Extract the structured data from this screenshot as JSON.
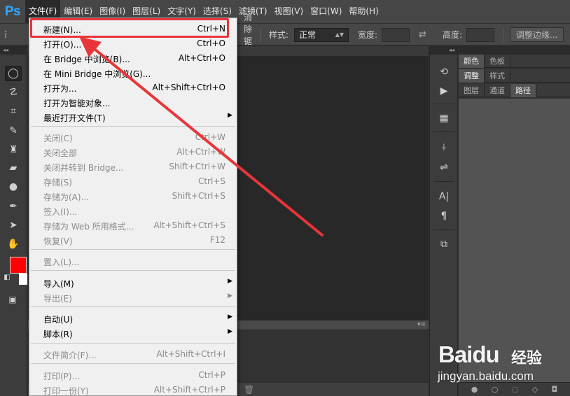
{
  "app": {
    "logo": "Ps"
  },
  "menubar": {
    "items": [
      "文件(F)",
      "编辑(E)",
      "图像(I)",
      "图层(L)",
      "文字(Y)",
      "选择(S)",
      "滤镜(T)",
      "视图(V)",
      "窗口(W)",
      "帮助(H)"
    ],
    "active": "文件(F)"
  },
  "options_bar": {
    "style_label": "样式:",
    "style_value": "正常",
    "width_label": "宽度:",
    "height_label": "高度:",
    "refine_edge_button": "调整边缘...",
    "partial_text": "消除锯齿"
  },
  "file_menu": {
    "items": [
      {
        "label": "新建(N)...",
        "shortcut": "Ctrl+N",
        "enabled": true,
        "highlighted": true
      },
      {
        "label": "打开(O)...",
        "shortcut": "Ctrl+O",
        "enabled": true
      },
      {
        "label": "在 Bridge 中浏览(B)...",
        "shortcut": "Alt+Ctrl+O",
        "enabled": true
      },
      {
        "label": "在 Mini Bridge 中浏览(G)...",
        "shortcut": "",
        "enabled": true
      },
      {
        "label": "打开为...",
        "shortcut": "Alt+Shift+Ctrl+O",
        "enabled": true
      },
      {
        "label": "打开为智能对象...",
        "shortcut": "",
        "enabled": true
      },
      {
        "label": "最近打开文件(T)",
        "shortcut": "",
        "enabled": true,
        "submenu": true
      },
      {
        "label": "关闭(C)",
        "shortcut": "Ctrl+W",
        "enabled": false
      },
      {
        "label": "关闭全部",
        "shortcut": "Alt+Ctrl+W",
        "enabled": false
      },
      {
        "label": "关闭并转到 Bridge...",
        "shortcut": "Shift+Ctrl+W",
        "enabled": false
      },
      {
        "label": "存储(S)",
        "shortcut": "Ctrl+S",
        "enabled": false
      },
      {
        "label": "存储为(A)...",
        "shortcut": "Shift+Ctrl+S",
        "enabled": false
      },
      {
        "label": "签入(I)...",
        "shortcut": "",
        "enabled": false
      },
      {
        "label": "存储为 Web 所用格式...",
        "shortcut": "Alt+Shift+Ctrl+S",
        "enabled": false
      },
      {
        "label": "恢复(V)",
        "shortcut": "F12",
        "enabled": false
      },
      {
        "label": "置入(L)...",
        "shortcut": "",
        "enabled": false
      },
      {
        "label": "导入(M)",
        "shortcut": "",
        "enabled": true,
        "submenu": true
      },
      {
        "label": "导出(E)",
        "shortcut": "",
        "enabled": false,
        "submenu": true
      },
      {
        "label": "自动(U)",
        "shortcut": "",
        "enabled": true,
        "submenu": true
      },
      {
        "label": "脚本(R)",
        "shortcut": "",
        "enabled": true,
        "submenu": true
      },
      {
        "label": "文件简介(F)...",
        "shortcut": "Alt+Shift+Ctrl+I",
        "enabled": false
      },
      {
        "label": "打印(P)...",
        "shortcut": "Ctrl+P",
        "enabled": false
      },
      {
        "label": "打印一份(Y)",
        "shortcut": "Alt+Shift+Ctrl+P",
        "enabled": false
      }
    ]
  },
  "tools": [
    "marquee-tool-icon",
    "lasso-tool-icon",
    "crop-tool-icon",
    "healing-brush-icon",
    "clone-stamp-icon",
    "eraser-icon",
    "blur-drop-icon",
    "pen-tool-icon",
    "path-select-icon",
    "hand-tool-icon"
  ],
  "colors": {
    "foreground": "#ff0000",
    "background": "#ffffff",
    "annotation": "#e8353a"
  },
  "panels": {
    "group1_tabs": [
      "颜色",
      "色板"
    ],
    "group2_tabs": [
      "调整",
      "样式"
    ],
    "group3_tabs": [
      "图层",
      "通道",
      "路径"
    ],
    "group3_active": "路径"
  },
  "watermark": {
    "logo": "Baidu",
    "brand": "经验",
    "url": "jingyan.baidu.com"
  }
}
